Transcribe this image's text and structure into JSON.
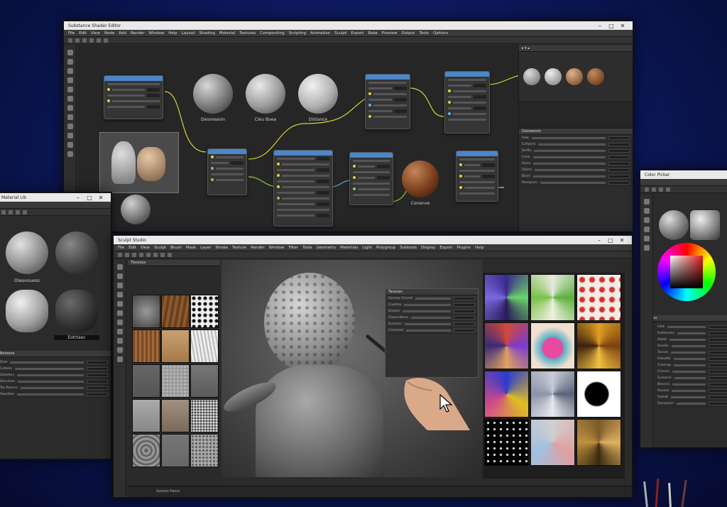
{
  "node_editor": {
    "title": "Substance Shader Editor",
    "menu": [
      "File",
      "Edit",
      "View",
      "Node",
      "Add",
      "Render",
      "Window",
      "Help",
      "Layout",
      "Shading",
      "Material",
      "Textures",
      "Compositing",
      "Scripting",
      "Animation",
      "Sculpt",
      "Export",
      "Bake",
      "Preview",
      "Output",
      "Tools",
      "Options"
    ],
    "spheres": [
      {
        "label": "Desoreaion"
      },
      {
        "label": "Cleu Boea"
      },
      {
        "label": "Distance"
      },
      {
        "label": "Conenve"
      }
    ],
    "props_title": "Deoowsnis",
    "props_rows": [
      "Sale",
      "Cofionrd",
      "Sarfia",
      "Cono",
      "Sacie",
      "Sfalrin",
      "Biisrt",
      "Panopsvn"
    ]
  },
  "material_panel": {
    "title": "Material Lib",
    "sphere_labels": [
      "Dlwavouess",
      "Eotrtaec"
    ],
    "section": "Botoons",
    "rows": [
      "Dirol",
      "Cotlees",
      "Goleetxs",
      "Dorivlees",
      "Tex Reavcs",
      "Swootles"
    ]
  },
  "sculpt_app": {
    "title": "Sculpt Studio",
    "menu": [
      "File",
      "Edit",
      "View",
      "Sculpt",
      "Brush",
      "Mask",
      "Layer",
      "Stroke",
      "Texture",
      "Render",
      "Window",
      "Filter",
      "Tools",
      "Geometry",
      "Materials",
      "Light",
      "Polygroup",
      "Subtools",
      "Display",
      "Export",
      "Plugins",
      "Help"
    ],
    "library_header": "Tiessoos",
    "status": "Sorosis Paner",
    "float_panel_title": "Tasauas",
    "float_rows": [
      "Sorraes Gnoret",
      "Coestea",
      "Dreaco",
      "Casenrwhve",
      "Sunosvs",
      "Caremasl"
    ]
  },
  "color_app": {
    "title": "Color Picker",
    "section": "Beeenu",
    "rows": [
      "Fatd",
      "Eedsecoes",
      "Saelis",
      "Socelis",
      "Tocsee",
      "Glesetts",
      "Cosonay",
      "Cineroc",
      "Sussacie",
      "Blvorce",
      "Sauoes",
      "Fazeds",
      "Sansyuers"
    ]
  },
  "colors": {
    "accent": "#4a86c8",
    "wire_yellow": "#d7d23a",
    "wire_green": "#8fc44a",
    "wire_blue": "#4fb0e0",
    "bg": "#0d1a5e"
  }
}
